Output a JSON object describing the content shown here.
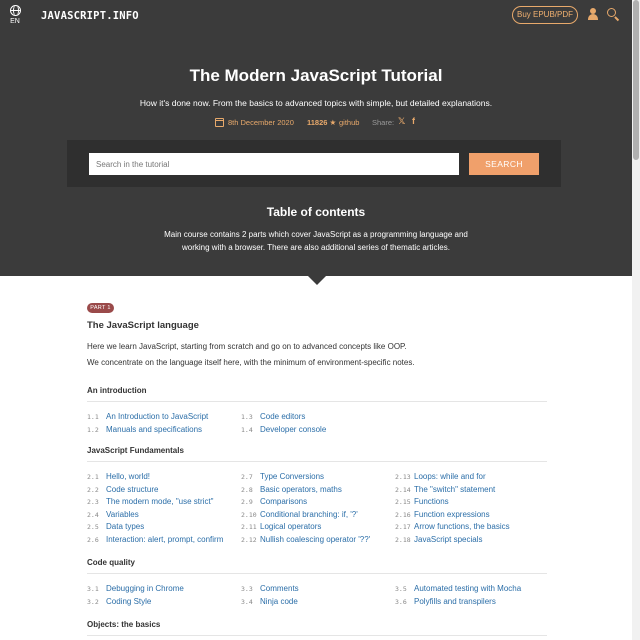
{
  "header": {
    "lang_code": "EN",
    "logo": "JAVASCRIPT.INFO",
    "buy_label": "Buy EPUB/PDF"
  },
  "hero": {
    "title": "The Modern JavaScript Tutorial",
    "subtitle": "How it's done now. From the basics to advanced topics with simple, but detailed explanations.",
    "date": "8th December 2020",
    "stars": "11826 ★",
    "github": "github",
    "share": "Share:"
  },
  "search": {
    "placeholder": "Search in the tutorial",
    "button": "SEARCH"
  },
  "toc": {
    "title": "Table of contents",
    "desc_1": "Main course contains 2 parts which cover JavaScript as a programming language and",
    "desc_2": "working with a browser. There are also additional series of thematic articles."
  },
  "part": {
    "badge": "PART 1",
    "title": "The JavaScript language",
    "desc_1": "Here we learn JavaScript, starting from scratch and go on to advanced concepts like OOP.",
    "desc_2": "We concentrate on the language itself here, with the minimum of environment-specific notes."
  },
  "sections": [
    {
      "title": "An introduction",
      "columns": [
        [
          {
            "num": "1.1",
            "label": "An Introduction to JavaScript"
          },
          {
            "num": "1.2",
            "label": "Manuals and specifications"
          }
        ],
        [
          {
            "num": "1.3",
            "label": "Code editors"
          },
          {
            "num": "1.4",
            "label": "Developer console"
          }
        ]
      ]
    },
    {
      "title": "JavaScript Fundamentals",
      "columns": [
        [
          {
            "num": "2.1",
            "label": "Hello, world!"
          },
          {
            "num": "2.2",
            "label": "Code structure"
          },
          {
            "num": "2.3",
            "label": "The modern mode, \"use strict\""
          },
          {
            "num": "2.4",
            "label": "Variables"
          },
          {
            "num": "2.5",
            "label": "Data types"
          },
          {
            "num": "2.6",
            "label": "Interaction: alert, prompt, confirm"
          }
        ],
        [
          {
            "num": "2.7",
            "label": "Type Conversions"
          },
          {
            "num": "2.8",
            "label": "Basic operators, maths"
          },
          {
            "num": "2.9",
            "label": "Comparisons"
          },
          {
            "num": "2.10",
            "label": "Conditional branching: if, '?'"
          },
          {
            "num": "2.11",
            "label": "Logical operators"
          },
          {
            "num": "2.12",
            "label": "Nullish coalescing operator '??'"
          }
        ],
        [
          {
            "num": "2.13",
            "label": "Loops: while and for"
          },
          {
            "num": "2.14",
            "label": "The \"switch\" statement"
          },
          {
            "num": "2.15",
            "label": "Functions"
          },
          {
            "num": "2.16",
            "label": "Function expressions"
          },
          {
            "num": "2.17",
            "label": "Arrow functions, the basics"
          },
          {
            "num": "2.18",
            "label": "JavaScript specials"
          }
        ]
      ]
    },
    {
      "title": "Code quality",
      "columns": [
        [
          {
            "num": "3.1",
            "label": "Debugging in Chrome"
          },
          {
            "num": "3.2",
            "label": "Coding Style"
          }
        ],
        [
          {
            "num": "3.3",
            "label": "Comments"
          },
          {
            "num": "3.4",
            "label": "Ninja code"
          }
        ],
        [
          {
            "num": "3.5",
            "label": "Automated testing with Mocha"
          },
          {
            "num": "3.6",
            "label": "Polyfills and transpilers"
          }
        ]
      ]
    },
    {
      "title": "Objects: the basics",
      "columns": []
    }
  ]
}
